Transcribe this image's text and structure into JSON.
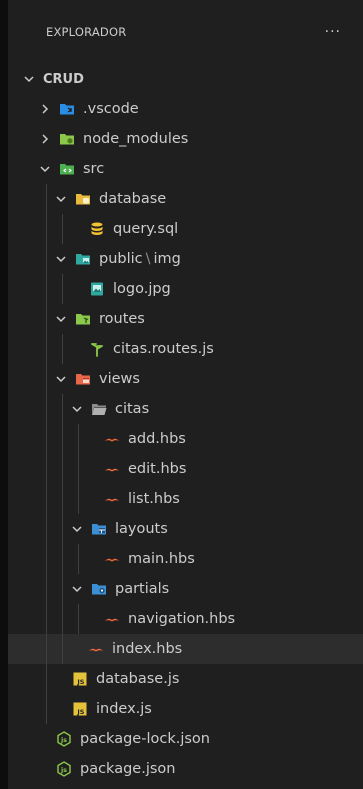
{
  "explorer": {
    "title": "EXPLORADOR",
    "more": "···",
    "root": "CRUD",
    "items": {
      "vscode": ".vscode",
      "node_modules": "node_modules",
      "src": "src",
      "database": "database",
      "query": "query.sql",
      "public": "public",
      "public_sep": "\\",
      "img": "img",
      "logo": "logo.jpg",
      "routes": "routes",
      "citas_routes": "citas.routes.js",
      "views": "views",
      "citas": "citas",
      "add": "add.hbs",
      "edit": "edit.hbs",
      "list": "list.hbs",
      "layouts": "layouts",
      "main": "main.hbs",
      "partials": "partials",
      "navigation": "navigation.hbs",
      "index_hbs": "index.hbs",
      "database_js": "database.js",
      "index_js": "index.js",
      "package_lock": "package-lock.json",
      "package": "package.json"
    },
    "colors": {
      "background": "#1f1f1f",
      "selected": "#2d2d2d",
      "text": "#cccccc",
      "folder_yellow": "#e8b93a",
      "folder_gray": "#8c8c8c",
      "folder_blue": "#3d8fd4",
      "vscode_blue": "#2a8ee6",
      "node_green": "#8cc84b",
      "src_green": "#4caf50",
      "views_red": "#e8664a",
      "hbs_orange": "#f26b3a",
      "js_yellow": "#e4c33a"
    }
  }
}
